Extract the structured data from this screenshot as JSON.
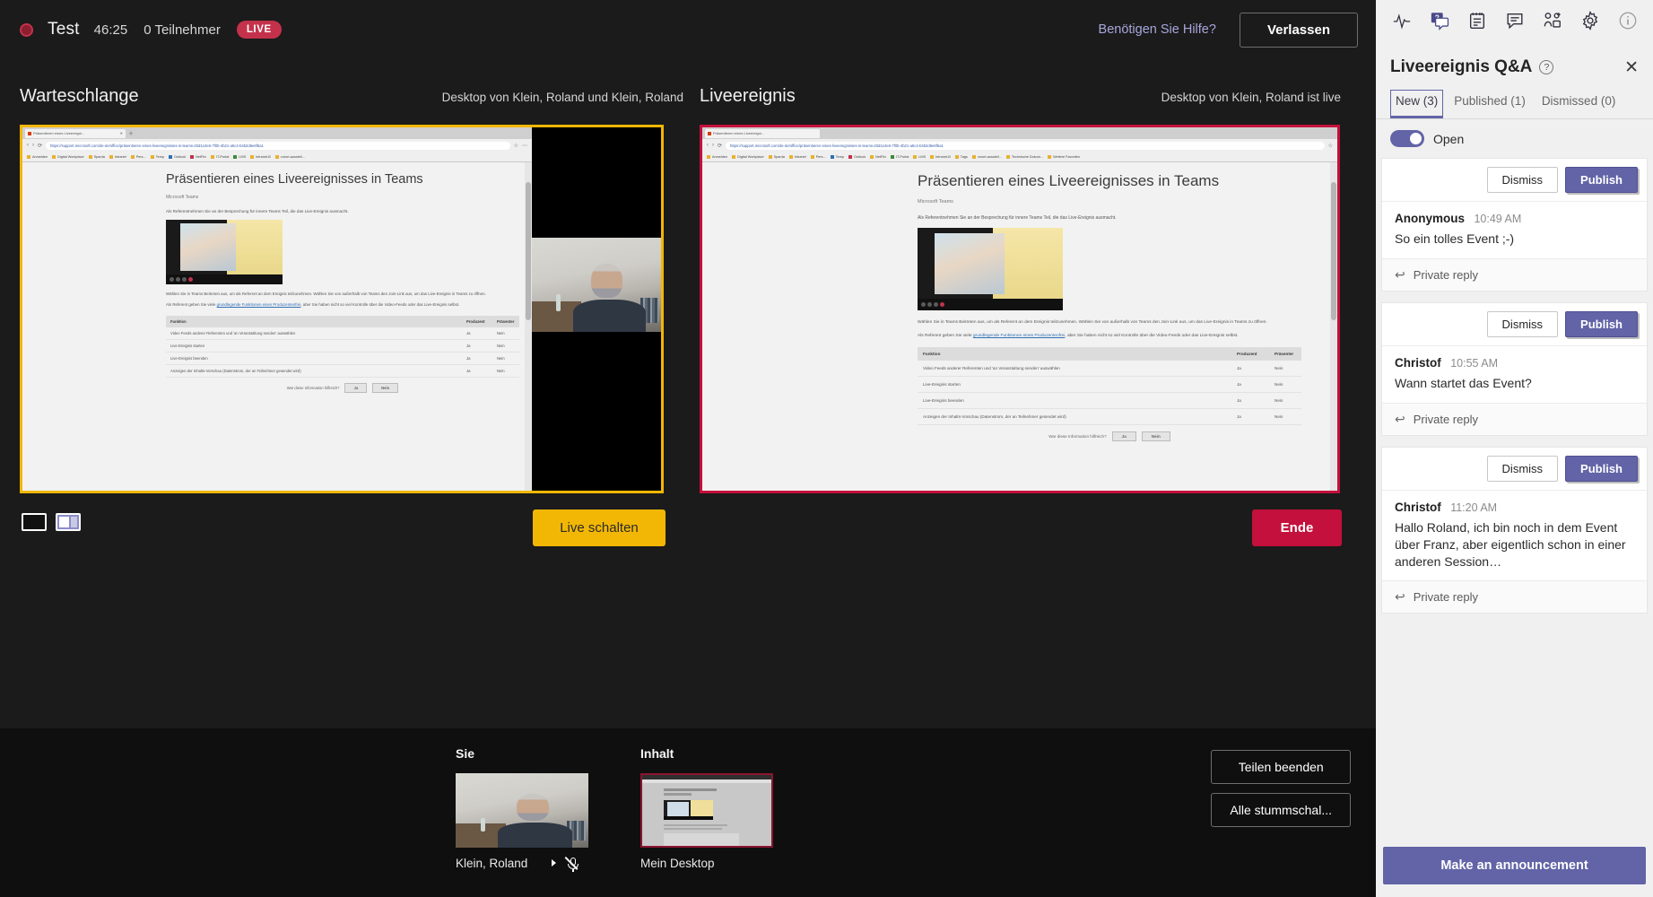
{
  "header": {
    "record_icon": "record-dot-icon",
    "title": "Test",
    "timer": "46:25",
    "attendees": "0 Teilnehmer",
    "live_badge": "LIVE",
    "help_link": "Benötigen Sie Hilfe?",
    "leave_button": "Verlassen"
  },
  "queue": {
    "title": "Warteschlange",
    "source": "Desktop von Klein, Roland und Klein, Roland",
    "go_live_button": "Live schalten",
    "layouts": [
      "layout-single-icon",
      "layout-split-icon"
    ],
    "border_color": "#f2b705"
  },
  "live": {
    "title": "Liveereignis",
    "source": "Desktop von Klein, Roland ist live",
    "end_button": "Ende",
    "border_color": "#c4103c"
  },
  "preview_doc": {
    "tab_title": "Präsentieren eines Liveereigni...",
    "url": "https://support.microsoft.com/de-de/office/präsentieren-eines-liveereignisses-in-teams-d3d1e2e6-7f0b-4b21-a5c4-b4b2d6e6f5a1",
    "bookmarks": [
      "Anmelden",
      "Digital Workplace",
      "Sparda",
      "Intranet",
      "Pers...",
      "Temp",
      "Outlook",
      "NetFlix",
      "IT-Portal",
      "LMS",
      "Intranet-B",
      "Tags",
      "New",
      "vorort-ausstell...",
      "Technische Dokum...",
      "Weitere Favoriten"
    ],
    "heading": "Präsentieren eines Liveereignisses in Teams",
    "subheading": "Microsoft Teams",
    "paragraph_1": "Als Referentnehmen Sie an der Besprechung für innere Teams Teil, die das Live-Ereignis ausmacht.",
    "paragraph_2": "Wählen Sie in Teams Beitreten aus, um als Referent an dem Ereignis teilzunehmen. Wählen Sie von außerhalb von Teams den Join-Link aus, um das Live-Ereignis in Teams zu öffnen.",
    "paragraph_3_pre": "Als Referent geben Sie viele ",
    "paragraph_3_link": "grundlegende Funktionen eines Produzentenfrei",
    "paragraph_3_post": ", aber Sie haben nicht so viel Kontrolle über die Video-Feeds oder das Live-Ereignis selbst.",
    "table_headers": [
      "Funktion",
      "Produzent",
      "Präsenter"
    ],
    "table_rows": [
      [
        "Video Feeds anderer Referenten und 'an Veranstaltung senden' auswählen",
        "Ja",
        "Nein"
      ],
      [
        "Live-Ereignis starten",
        "Ja",
        "Nein"
      ],
      [
        "Live-Ereignis beenden",
        "Ja",
        "Nein"
      ],
      [
        "Anzeigen der Inhalts-Vorschau (Datenstrom, der an Teilnehmer gesendet wird)",
        "Ja",
        "Nein"
      ]
    ],
    "footer_question": "War diese Information hilfreich?",
    "footer_yes": "Ja",
    "footer_no": "Nein"
  },
  "tray": {
    "you_label": "Sie",
    "you_name": "Klein, Roland",
    "you_camera_icon": "camera-icon",
    "you_mic_icon": "mic-muted-icon",
    "content_label": "Inhalt",
    "content_name": "Mein Desktop",
    "stop_share_button": "Teilen beenden",
    "mute_all_button": "Alle stummschal..."
  },
  "sidepanel": {
    "icons": [
      "health-pulse-icon",
      "qa-icon",
      "notes-icon",
      "chat-icon",
      "add-people-icon",
      "settings-gear-icon",
      "info-icon"
    ],
    "active_icon_index": 1,
    "title": "Liveereignis Q&A",
    "help_glyph": "?",
    "close_glyph": "✕",
    "tabs": [
      {
        "label": "New (3)",
        "active": true
      },
      {
        "label": "Published (1)",
        "active": false
      },
      {
        "label": "Dismissed (0)",
        "active": false
      }
    ],
    "open_toggle_label": "Open",
    "open_toggle_on": true,
    "accent_color": "#6264a7",
    "dismiss_label": "Dismiss",
    "publish_label": "Publish",
    "private_reply_label": "Private reply",
    "questions": [
      {
        "author": "Anonymous",
        "time": "10:49 AM",
        "text": "So ein tolles Event ;-)"
      },
      {
        "author": "Christof",
        "time": "10:55 AM",
        "text": "Wann startet das Event?"
      },
      {
        "author": "Christof",
        "time": "11:20 AM",
        "text": "Hallo Roland, ich bin noch in dem Event über Franz, aber eigentlich schon in einer anderen Session…"
      }
    ],
    "announce_button": "Make an announcement"
  }
}
